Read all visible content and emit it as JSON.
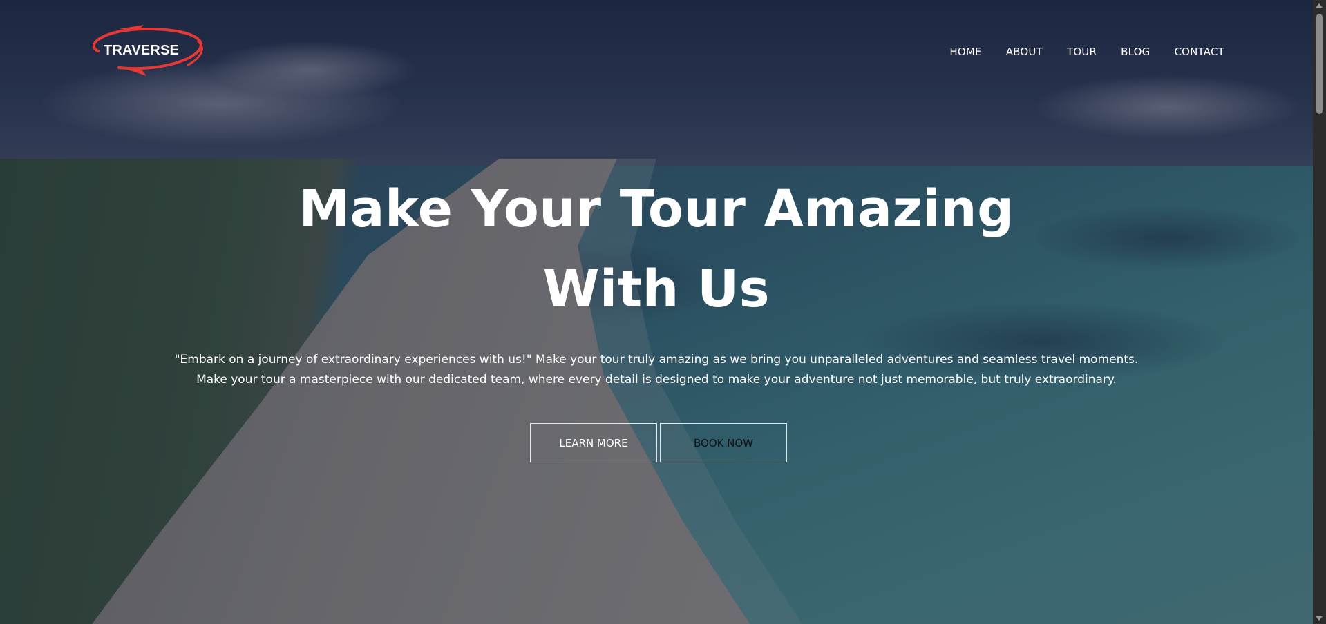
{
  "brand": {
    "name": "TRAVERSE",
    "accent_color": "#e53935"
  },
  "nav": {
    "items": [
      {
        "label": "HOME"
      },
      {
        "label": "ABOUT"
      },
      {
        "label": "TOUR"
      },
      {
        "label": "BLOG"
      },
      {
        "label": "CONTACT"
      }
    ]
  },
  "hero": {
    "title_line1": "Make Your Tour Amazing",
    "title_line2": "With Us",
    "description_line1": "\"Embark on a journey of extraordinary experiences with us!\" Make your tour truly amazing as we bring you unparalleled adventures and seamless travel moments.",
    "description_line2": "Make your tour a masterpiece with our dedicated team, where every detail is designed to make your adventure not just memorable, but truly extraordinary.",
    "buttons": {
      "learn_more": "LEARN MORE",
      "book_now": "BOOK NOW"
    }
  },
  "background": {
    "icon": "beach-aerial-image"
  }
}
